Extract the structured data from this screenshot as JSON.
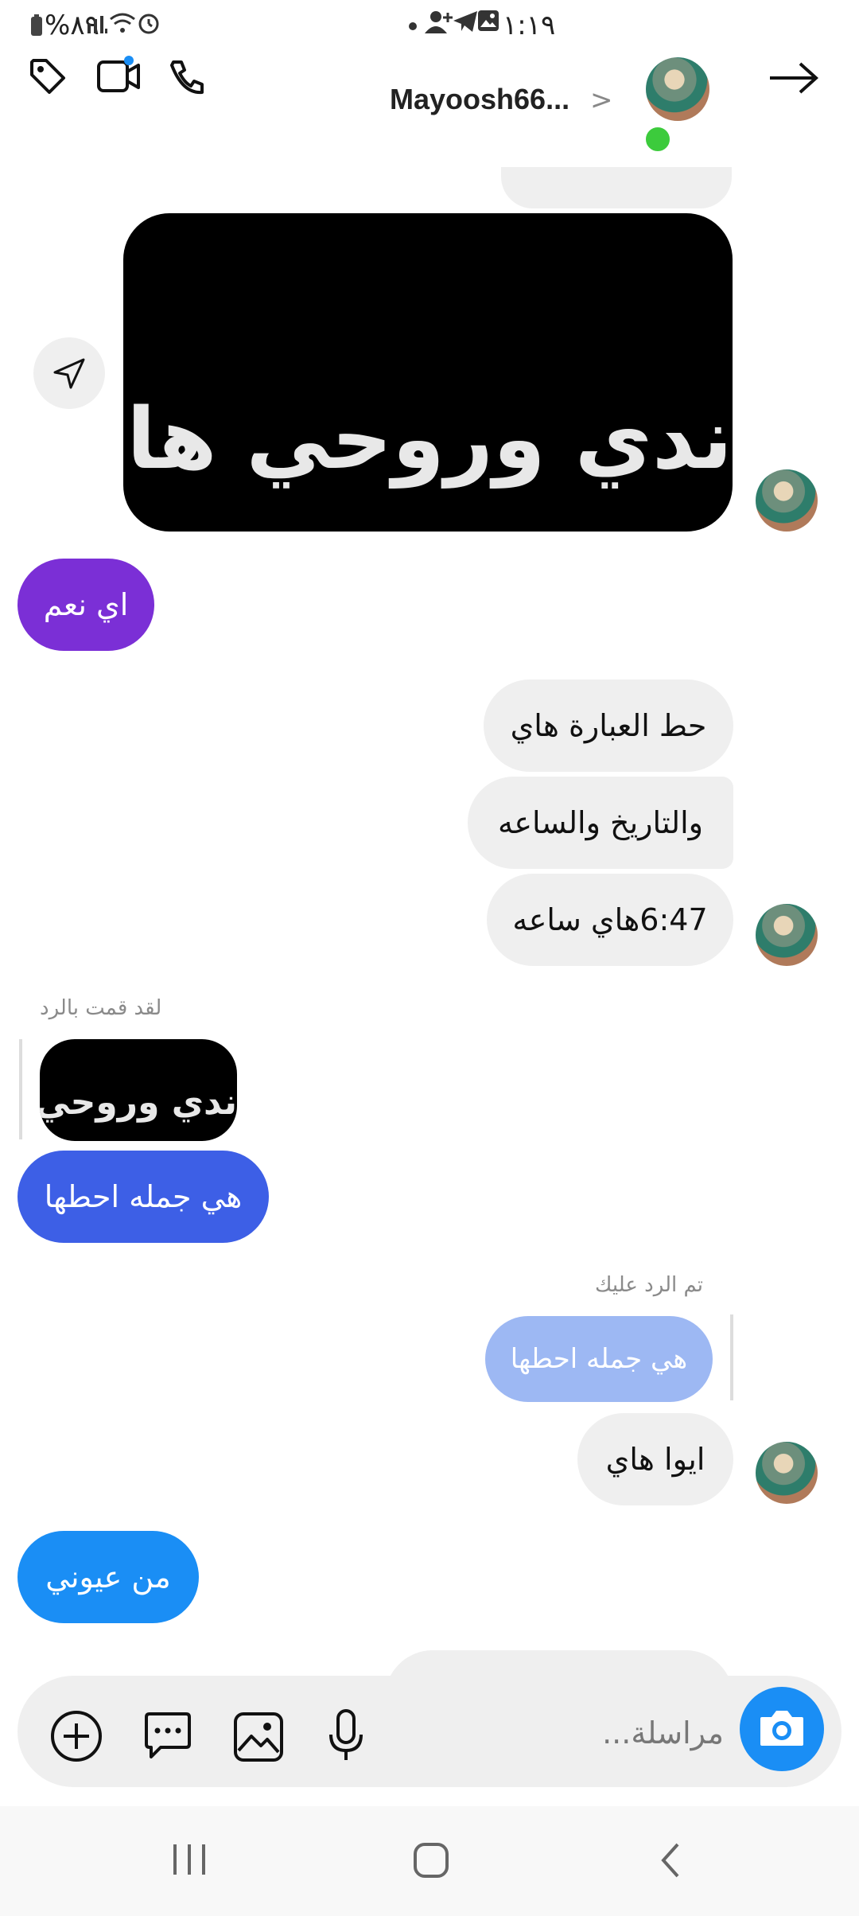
{
  "status_bar": {
    "battery": "%٨٩",
    "time": "١:١٩"
  },
  "header": {
    "username": "Mayoosh66...",
    "chevron": ">"
  },
  "messages": {
    "image_text": "ندي وروحي هاب",
    "out_1": "اي نعم",
    "in_1": "حط العبارة هاي",
    "in_2": "والتاريخ والساعه",
    "in_3": "6:47هاي ساعه",
    "you_replied_label": "لقد قمت بالرد",
    "reply_thumb_text": "ندي وروحي هاب",
    "out_2": "هي جمله احطها",
    "replied_to_you_label": "تم الرد عليك",
    "quoted_reply": "هي جمله احطها",
    "in_4": "ايوا هاي",
    "out_3": "من عيوني"
  },
  "composer": {
    "placeholder": "مراسلة..."
  },
  "colors": {
    "purple_bubble": "#7b2fd6",
    "blue_bubble_1": "#3d5fe6",
    "blue_bubble_2": "#1a8ef5",
    "quoted_bubble": "#9db8f3",
    "incoming_bubble": "#efefef",
    "online_dot": "#3ccb3c"
  },
  "icons": {
    "status_left": [
      "battery-icon",
      "signal-icon",
      "wifi-icon",
      "alarm-icon"
    ],
    "status_right": [
      "dot-icon",
      "add-contact-icon",
      "telegram-icon",
      "gallery-icon"
    ],
    "header": [
      "tag-icon",
      "video-call-icon",
      "phone-icon",
      "back-arrow-icon"
    ],
    "composer": [
      "add-icon",
      "sticker-icon",
      "gallery-icon",
      "microphone-icon",
      "camera-icon"
    ],
    "nav": [
      "recent-apps-icon",
      "home-icon",
      "back-icon"
    ]
  }
}
